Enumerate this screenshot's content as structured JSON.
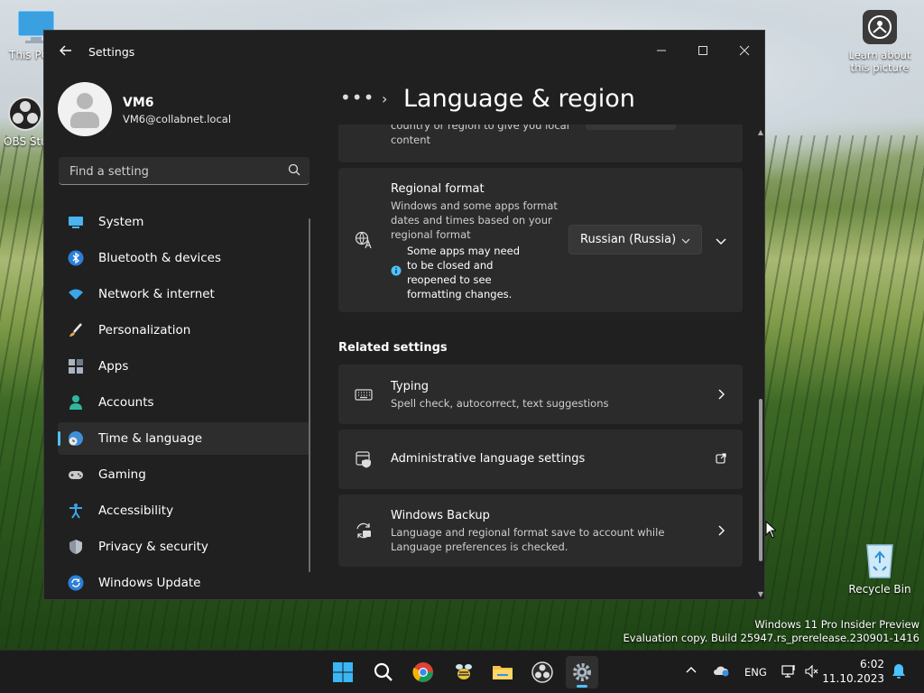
{
  "desktop": {
    "icons": [
      {
        "label": "This PC"
      },
      {
        "label": "OBS Studio"
      },
      {
        "label": "Learn about this picture"
      },
      {
        "label": "Recycle Bin"
      }
    ],
    "watermark": {
      "line1": "Windows 11 Pro Insider Preview",
      "line2": "Evaluation copy. Build 25947.rs_prerelease.230901-1416"
    }
  },
  "window": {
    "title": "Settings",
    "controls": {
      "minimize": "—",
      "maximize": "☐",
      "close": "✕"
    }
  },
  "profile": {
    "name": "VM6",
    "email": "VM6@collabnet.local"
  },
  "search": {
    "placeholder": "Find a setting"
  },
  "nav": {
    "items": [
      {
        "label": "System",
        "icon": "monitor-icon"
      },
      {
        "label": "Bluetooth & devices",
        "icon": "bluetooth-icon"
      },
      {
        "label": "Network & internet",
        "icon": "wifi-icon"
      },
      {
        "label": "Personalization",
        "icon": "brush-icon"
      },
      {
        "label": "Apps",
        "icon": "apps-icon"
      },
      {
        "label": "Accounts",
        "icon": "person-icon"
      },
      {
        "label": "Time & language",
        "icon": "globe-clock-icon",
        "active": true
      },
      {
        "label": "Gaming",
        "icon": "gamepad-icon"
      },
      {
        "label": "Accessibility",
        "icon": "accessibility-icon"
      },
      {
        "label": "Privacy & security",
        "icon": "shield-icon"
      },
      {
        "label": "Windows Update",
        "icon": "update-icon"
      }
    ]
  },
  "breadcrumb": {
    "dots": "•••",
    "chevron": "›",
    "title": "Language & region"
  },
  "content": {
    "partial_card": {
      "text": "country or region to give you local content"
    },
    "regional_format": {
      "title": "Regional format",
      "description": "Windows and some apps format dates and times based on your regional format",
      "note": "Some apps may need to be closed and reopened to see formatting changes.",
      "dropdown_value": "Russian (Russia)"
    },
    "related_heading": "Related settings",
    "related": [
      {
        "title": "Typing",
        "description": "Spell check, autocorrect, text suggestions"
      },
      {
        "title": "Administrative language settings",
        "description": ""
      },
      {
        "title": "Windows Backup",
        "description": "Language and regional format save to account while Language preferences is checked."
      }
    ]
  },
  "taskbar": {
    "apps": [
      "start-icon",
      "search-icon",
      "chrome-icon",
      "bee-app-icon",
      "file-explorer-icon",
      "obs-icon",
      "settings-icon"
    ],
    "tray": {
      "language": "ENG",
      "time": "6:02",
      "date": "11.10.2023"
    }
  },
  "colors": {
    "accent": "#4cc2ff",
    "window_bg": "#202020",
    "card_bg": "#2b2b2b"
  }
}
